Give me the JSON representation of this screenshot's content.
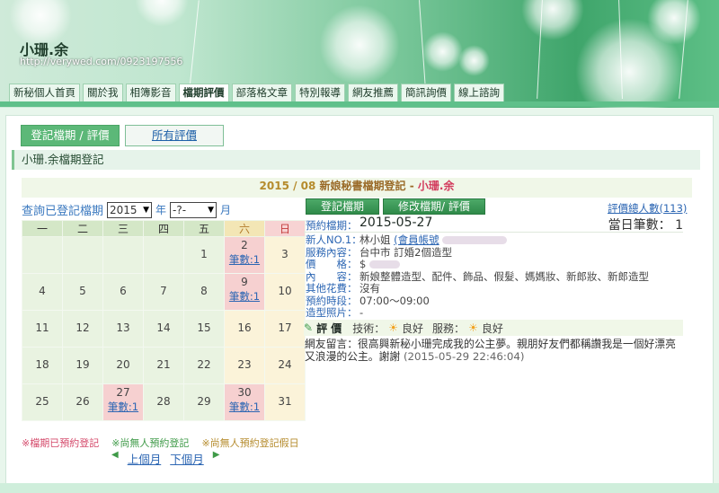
{
  "site": {
    "title": "小珊.余",
    "url": "http://verywed.com/0923197556"
  },
  "nav": [
    {
      "label": "新秘個人首頁",
      "active": false
    },
    {
      "label": "關於我",
      "active": false
    },
    {
      "label": "相簿影音",
      "active": false
    },
    {
      "label": "檔期評價",
      "active": true
    },
    {
      "label": "部落格文章",
      "active": false
    },
    {
      "label": "特別報導",
      "active": false
    },
    {
      "label": "網友推薦",
      "active": false
    },
    {
      "label": "簡訊詢價",
      "active": false
    },
    {
      "label": "線上諮詢",
      "active": false
    }
  ],
  "tabs": [
    {
      "label": "登記檔期 / 評價",
      "active": true
    },
    {
      "label": "所有評價",
      "active": false
    }
  ],
  "section_title": "小珊.余檔期登記",
  "content_title": {
    "year_month": "2015 / 08",
    "text": "新娘秘書檔期登記 -",
    "name": "小珊.余"
  },
  "query": {
    "label": "查詢已登記檔期",
    "year": "2015",
    "year_unit": "年",
    "month": "-?-",
    "month_unit": "月"
  },
  "calendar": {
    "weekdays": [
      "一",
      "二",
      "三",
      "四",
      "五",
      "六",
      "日"
    ],
    "weeks": [
      [
        {
          "d": ""
        },
        {
          "d": ""
        },
        {
          "d": ""
        },
        {
          "d": ""
        },
        {
          "d": "1"
        },
        {
          "d": "2",
          "link": "筆數:1",
          "booked": true
        },
        {
          "d": "3"
        }
      ],
      [
        {
          "d": "4"
        },
        {
          "d": "5"
        },
        {
          "d": "6"
        },
        {
          "d": "7"
        },
        {
          "d": "8"
        },
        {
          "d": "9",
          "link": "筆數:1",
          "booked": true
        },
        {
          "d": "10"
        }
      ],
      [
        {
          "d": "11"
        },
        {
          "d": "12"
        },
        {
          "d": "13"
        },
        {
          "d": "14"
        },
        {
          "d": "15"
        },
        {
          "d": "16"
        },
        {
          "d": "17"
        }
      ],
      [
        {
          "d": "18"
        },
        {
          "d": "19"
        },
        {
          "d": "20"
        },
        {
          "d": "21"
        },
        {
          "d": "22"
        },
        {
          "d": "23"
        },
        {
          "d": "24"
        }
      ],
      [
        {
          "d": "25"
        },
        {
          "d": "26"
        },
        {
          "d": "27",
          "link": "筆數:1",
          "booked": true
        },
        {
          "d": "28"
        },
        {
          "d": "29"
        },
        {
          "d": "30",
          "link": "筆數:1",
          "booked": true
        },
        {
          "d": "31"
        }
      ]
    ]
  },
  "legend": {
    "booked": "※檔期已預約登記",
    "free": "※尚無人預約登記",
    "free_holiday": "※尚無人預約登記假日"
  },
  "pager": {
    "prev": "上個月",
    "next": "下個月"
  },
  "actions": {
    "register": "登記檔期",
    "modify": "修改檔期/ 評價",
    "total_reviews": "評價總人數(113)"
  },
  "detail": {
    "booking_label": "預約檔期：",
    "booking_date": "2015-05-27",
    "daily_count": "當日筆數： 1",
    "rows": [
      {
        "k": "新人NO.1：",
        "v": "林小姐",
        "extra": "(會員帳號"
      },
      {
        "k": "服務內容：",
        "v": "台中市 訂婚2個造型"
      },
      {
        "k": "價　　格：",
        "v": "$"
      },
      {
        "k": "內　　容：",
        "v": "新娘整體造型、配件、飾品、假髮、媽媽妝、新郎妝、新郎造型"
      },
      {
        "k": "其他花費：",
        "v": "沒有"
      },
      {
        "k": "預約時段：",
        "v": "07:00～09:00"
      },
      {
        "k": "造型照片：",
        "v": "-"
      }
    ],
    "rating": {
      "title": "評 價",
      "tech_label": "技術：",
      "tech_value": "良好",
      "service_label": "服務：",
      "service_value": "良好"
    },
    "comment": "網友留言：很高興新秘小珊完成我的公主夢。親朋好友們都稱讚我是一個好漂亮又浪漫的公主。謝謝",
    "comment_date": "(2015-05-29 22:46:04)"
  },
  "colors": {
    "accent_green": "#5cb878",
    "booked_pink": "#f6d0d0",
    "link_blue": "#2c66b3"
  }
}
